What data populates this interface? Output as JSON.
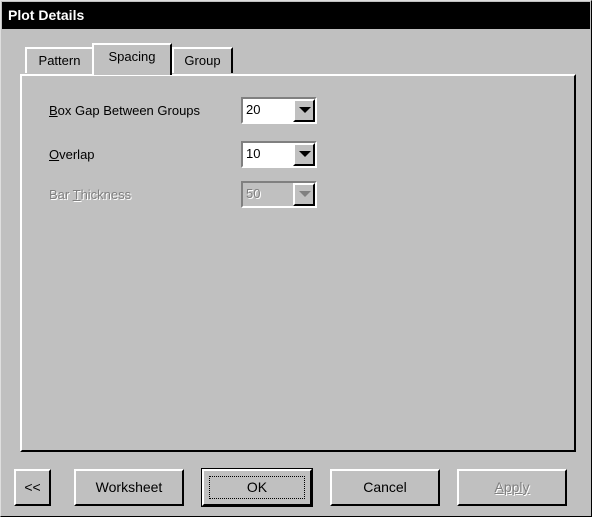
{
  "window": {
    "title": "Plot Details"
  },
  "tabs": [
    {
      "label": "Pattern",
      "active": false
    },
    {
      "label": "Spacing",
      "active": true
    },
    {
      "label": "Group",
      "active": false
    }
  ],
  "spacing": {
    "box_gap": {
      "label_first": "B",
      "label_rest": "ox Gap Between Groups",
      "value": "20"
    },
    "overlap": {
      "label_first": "O",
      "label_rest": "verlap",
      "value": "10"
    },
    "bar_thickness": {
      "label_pre": "Bar ",
      "label_first": "T",
      "label_rest": "hickness",
      "value": "50",
      "enabled": false
    }
  },
  "buttons": {
    "back": "<<",
    "worksheet": "Worksheet",
    "ok": "OK",
    "cancel": "Cancel",
    "apply": "Apply"
  },
  "icons": {
    "dropdown": "chevron-down-icon"
  },
  "colors": {
    "titlebar": "#000000",
    "face": "#c0c0c0",
    "disabled_text": "#808080"
  }
}
